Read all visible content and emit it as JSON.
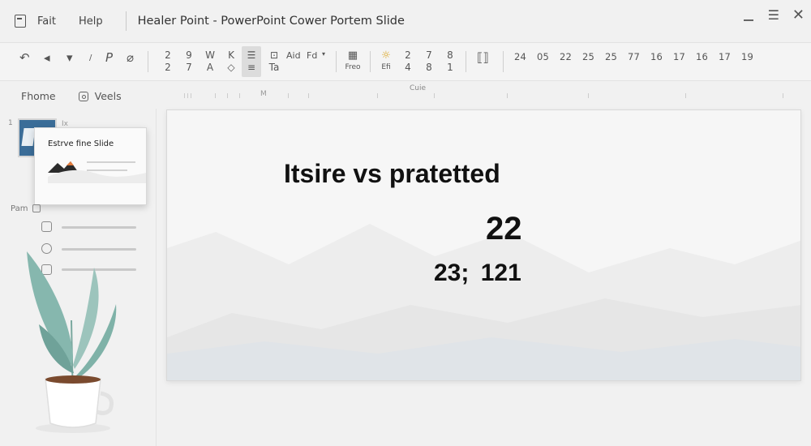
{
  "menu": {
    "items": [
      "Fait",
      "Help"
    ],
    "doc_title": "Healer Point - PowerPoint Cower Portem Slide"
  },
  "ribbon": {
    "stack1": [
      "2",
      "2"
    ],
    "stack2": [
      "9",
      "7"
    ],
    "stack3": [
      "W",
      "A"
    ],
    "stack4": [
      "K",
      "◇"
    ],
    "stack6": [
      "⊡",
      "Ta"
    ],
    "aid_label": "Aid",
    "fd_label": "Fd",
    "freo_label": "Freo",
    "efi_label": "Efi",
    "stack7": [
      "2",
      "4"
    ],
    "stack8": [
      "7",
      "8"
    ],
    "stack9": [
      "8",
      "1"
    ],
    "numbers": [
      "24",
      "05",
      "22",
      "25",
      "25",
      "77",
      "16",
      "17",
      "16",
      "17",
      "19"
    ],
    "caption": "Cuie"
  },
  "subtabs": {
    "home": "Fhome",
    "views": "Veels"
  },
  "ruler": {
    "mark": "M"
  },
  "left_panel": {
    "slide_card_title": "Estrve fine Slide",
    "label": "Pam"
  },
  "slide": {
    "title": "Itsire vs pratetted",
    "big_number": "22",
    "values": "23;  121"
  },
  "colors": {
    "background": "#f1f1f1",
    "slide_bg": "#f6f6f6",
    "thumb_blue": "#3b6d98",
    "leaf": "#86b7ae",
    "mountain_orange": "#e07a3c"
  }
}
